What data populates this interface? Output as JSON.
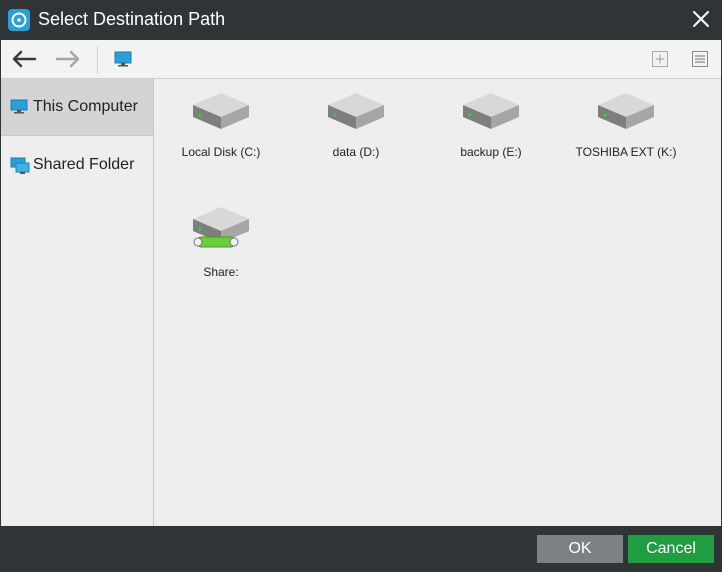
{
  "window": {
    "title": "Select Destination Path"
  },
  "toolbar": {
    "back_icon": "back-arrow-icon",
    "forward_icon": "forward-arrow-icon",
    "computer_icon": "computer-icon",
    "new_folder_icon": "new-folder-icon",
    "view_icon": "list-view-icon"
  },
  "sidebar": {
    "items": [
      {
        "label": "This Computer",
        "icon": "computer-icon",
        "active": true
      },
      {
        "label": "Shared Folder",
        "icon": "shared-folder-icon",
        "active": false
      }
    ]
  },
  "drives": [
    {
      "label": "Local Disk (C:)"
    },
    {
      "label": "data (D:)"
    },
    {
      "label": "backup (E:)"
    },
    {
      "label": "TOSHIBA EXT (K:)"
    },
    {
      "label": "Share:"
    }
  ],
  "footer": {
    "ok_label": "OK",
    "cancel_label": "Cancel"
  },
  "colors": {
    "titlebar": "#2f3436",
    "ok": "#7d8184",
    "cancel": "#1e9d41",
    "accent": "#2aa0d8"
  }
}
